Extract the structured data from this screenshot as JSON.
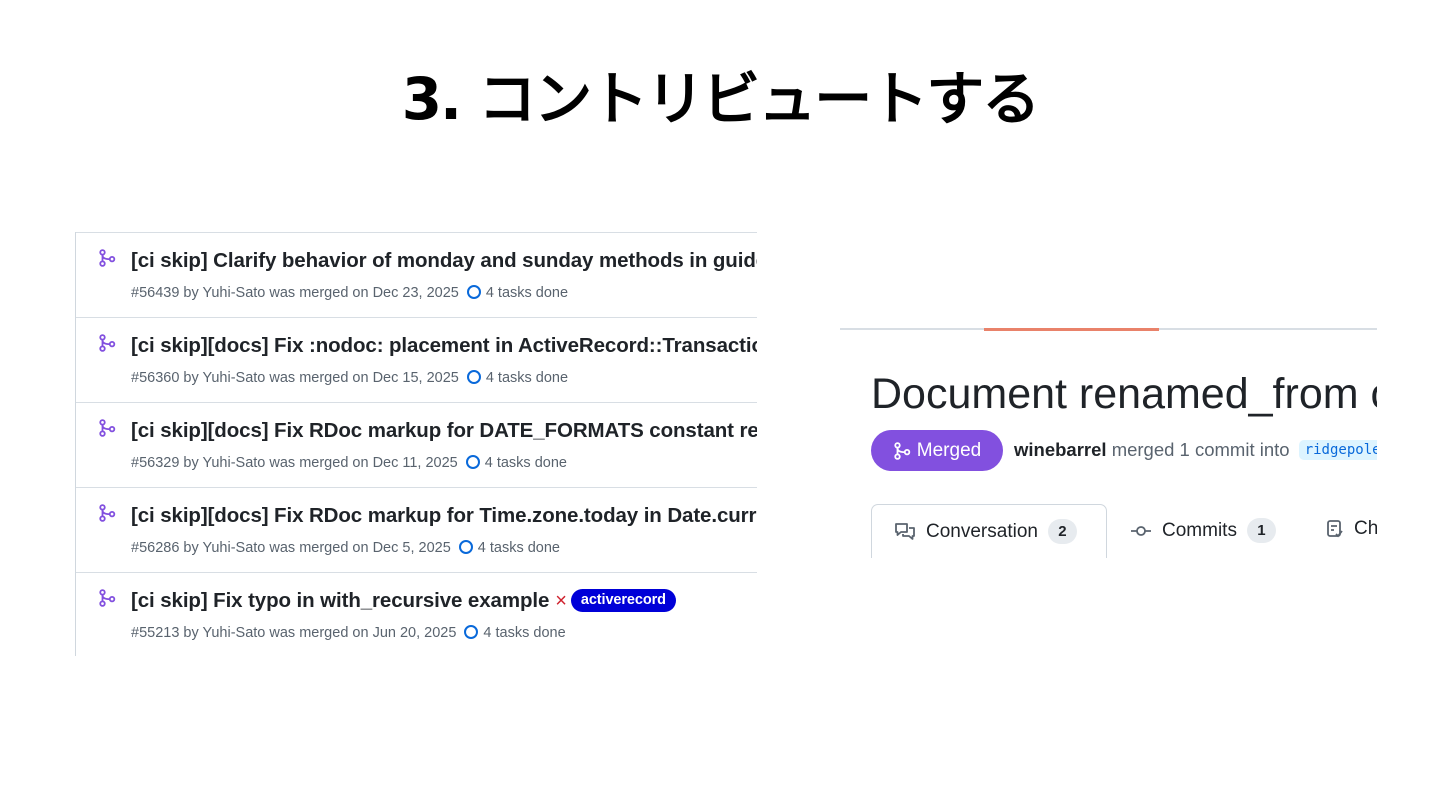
{
  "slide": {
    "title": "3. コントリビュートする"
  },
  "pr_list": {
    "rows": [
      {
        "title": "[ci skip] Clarify behavior of monday and sunday methods in guides",
        "meta": "#56439 by Yuhi-Sato was merged on Dec 23, 2025",
        "tasks": "4 tasks done"
      },
      {
        "title": "[ci skip][docs] Fix :nodoc: placement in ActiveRecord::Transactions",
        "meta": "#56360 by Yuhi-Sato was merged on Dec 15, 2025",
        "tasks": "4 tasks done"
      },
      {
        "title": "[ci skip][docs] Fix RDoc markup for DATE_FORMATS constant reference",
        "meta": "#56329 by Yuhi-Sato was merged on Dec 11, 2025",
        "tasks": "4 tasks done"
      },
      {
        "title": "[ci skip][docs] Fix RDoc markup for Time.zone.today in Date.current",
        "meta": "#56286 by Yuhi-Sato was merged on Dec 5, 2025",
        "tasks": "4 tasks done"
      },
      {
        "title": "[ci skip] Fix typo in with_recursive example",
        "meta": "#55213 by Yuhi-Sato was merged on Jun 20, 2025",
        "tasks": "4 tasks done",
        "status_mark": "×",
        "label": "activerecord"
      }
    ]
  },
  "pr_page": {
    "heading": "Document renamed_from option",
    "state": "Merged",
    "author": "winebarrel",
    "merge_text": "merged 1 commit into",
    "branch": "ridgepole:main",
    "tabs": [
      {
        "label": "Conversation",
        "count": "2"
      },
      {
        "label": "Commits",
        "count": "1"
      },
      {
        "label": "Checks"
      }
    ]
  },
  "colors": {
    "merged": "#8250df",
    "task_blue": "#0969da",
    "label_bg": "#0000d8",
    "accent_rule": "#e9826a",
    "close_red": "#cf222e"
  }
}
